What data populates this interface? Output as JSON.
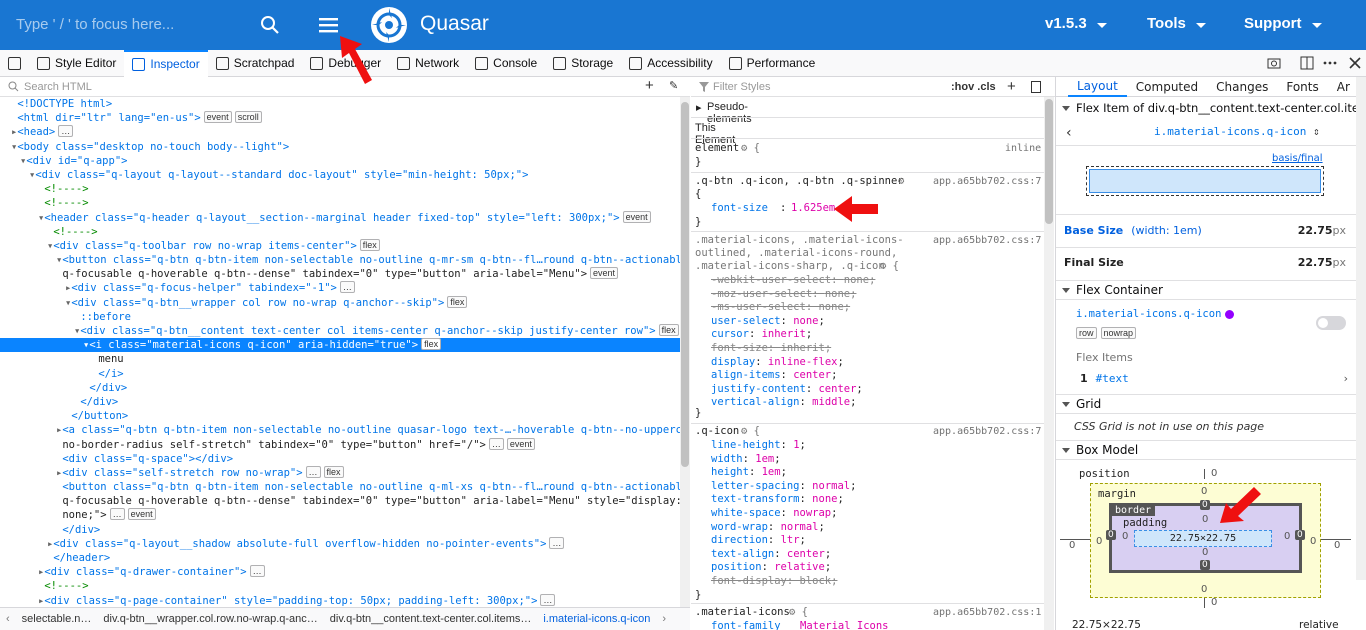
{
  "header": {
    "search_placeholder": "Type ' / ' to focus here...",
    "brand": "Quasar",
    "version": "v1.5.3",
    "tools": "Tools",
    "support": "Support",
    "brand_color": "#1976d2"
  },
  "devtools": {
    "tabs": [
      "Style Editor",
      "Inspector",
      "Scratchpad",
      "Debugger",
      "Network",
      "Console",
      "Storage",
      "Accessibility",
      "Performance"
    ],
    "selected_tab": "Inspector",
    "search_html_placeholder": "Search HTML",
    "tree": [
      "<!DOCTYPE html>",
      "<html dir=\"ltr\" lang=\"en-us\">",
      "<head>",
      "<body class=\"desktop no-touch body--light\">",
      "<div id=\"q-app\">",
      "<div class=\"q-layout q-layout--standard doc-layout\" style=\"min-height: 50px;\">",
      "<!---->",
      "<!---->",
      "<header class=\"q-header q-layout__section--marginal header fixed-top\" style=\"left: 300px;\">",
      "<!---->",
      "<div class=\"q-toolbar row no-wrap items-center\">",
      "<button class=\"q-btn q-btn-item non-selectable no-outline q-mr-sm q-btn--fl…round q-btn--actionable",
      "q-focusable q-hoverable q-btn--dense\" tabindex=\"0\" type=\"button\" aria-label=\"Menu\">",
      "<div class=\"q-focus-helper\" tabindex=\"-1\">",
      "<div class=\"q-btn__wrapper col row no-wrap q-anchor--skip\">",
      "::before",
      "<div class=\"q-btn__content text-center col items-center q-anchor--skip justify-center row\">",
      "<i class=\"material-icons q-icon\" aria-hidden=\"true\">",
      "menu",
      "</i>",
      "</div>",
      "</div>",
      "</button>",
      "<a class=\"q-btn q-btn-item non-selectable no-outline quasar-logo text-…-hoverable q-btn--no-uppercase",
      "no-border-radius self-stretch\" tabindex=\"0\" type=\"button\" href=\"/\">",
      "<div class=\"q-space\"></div>",
      "<div class=\"self-stretch row no-wrap\">",
      "<button class=\"q-btn q-btn-item non-selectable no-outline q-ml-xs q-btn--fl…round q-btn--actionable",
      "q-focusable q-hoverable q-btn--dense\" tabindex=\"0\" type=\"button\" aria-label=\"Menu\" style=\"display:",
      "none;\">",
      "</div>",
      "<div class=\"q-layout__shadow absolute-full overflow-hidden no-pointer-events\">",
      "</header>",
      "<div class=\"q-drawer-container\">",
      "<!---->",
      "<div class=\"q-page-container\" style=\"padding-top: 50px; padding-left: 300px;\">"
    ],
    "badges": {
      "event": "event",
      "scroll": "scroll",
      "flex": "flex"
    },
    "breadcrumbs": [
      "selectable.n…",
      "div.q-btn__wrapper.col.row.no-wrap.q-anc…",
      "div.q-btn__content.text-center.col.items…",
      "i.material-icons.q-icon"
    ]
  },
  "rules": {
    "filter_placeholder": "Filter Styles",
    "hov_cls": ":hov .cls",
    "pseudo": "Pseudo-elements",
    "this_element": "This Element",
    "element_rule": "element",
    "inline": "inline",
    "r1_selector": ".q-btn .q-icon, .q-btn .q-spinner",
    "r1_source": "app.a65bb702.css:7",
    "r1_prop": "font-size",
    "r1_val": "1.625em",
    "r2_selector_a": ".material-icons, .material-icons-",
    "r2_selector_b": "outlined, .material-icons-round,",
    "r2_selector_c": ".material-icons-sharp, .q-icon",
    "r2_source": "app.a65bb702.css:7",
    "r2_props": [
      [
        "-webkit-user-select",
        "none",
        true
      ],
      [
        "-moz-user-select",
        "none",
        true
      ],
      [
        "-ms-user-select",
        "none",
        true
      ],
      [
        "user-select",
        "none",
        false
      ],
      [
        "cursor",
        "inherit",
        false
      ],
      [
        "font-size",
        "inherit",
        true
      ],
      [
        "display",
        "inline-flex",
        false
      ],
      [
        "align-items",
        "center",
        false
      ],
      [
        "justify-content",
        "center",
        false
      ],
      [
        "vertical-align",
        "middle",
        false
      ]
    ],
    "r3_selector": ".q-icon",
    "r3_source": "app.a65bb702.css:7",
    "r3_props": [
      [
        "line-height",
        "1",
        false
      ],
      [
        "width",
        "1em",
        false
      ],
      [
        "height",
        "1em",
        false
      ],
      [
        "letter-spacing",
        "normal",
        false
      ],
      [
        "text-transform",
        "none",
        false
      ],
      [
        "white-space",
        "nowrap",
        false
      ],
      [
        "word-wrap",
        "normal",
        false
      ],
      [
        "direction",
        "ltr",
        false
      ],
      [
        "text-align",
        "center",
        false
      ],
      [
        "position",
        "relative",
        false
      ],
      [
        "font-display",
        "block",
        true
      ]
    ],
    "r4_selector": ".material-icons",
    "r4_source": "app.a65bb702.css:1",
    "r4_prop": "font-family",
    "r4_val": "Material Icons"
  },
  "layout": {
    "tabs": [
      "Layout",
      "Computed",
      "Changes",
      "Fonts",
      "Ar"
    ],
    "flex_item_title": "Flex Item of div.q-btn__content.text-center.col.ite…",
    "item_selector": "i.material-icons.q-icon",
    "basis_label": "basis/final",
    "base_size_label": "Base Size",
    "base_size_note": "(width: 1em)",
    "base_size_value": "22.75",
    "final_size_label": "Final Size",
    "final_size_value": "22.75",
    "px": "px",
    "flex_container": "Flex Container",
    "container_selector": "i.material-icons.q-icon",
    "row": "row",
    "nowrap": "nowrap",
    "flex_items": "Flex Items",
    "flex_item_index": "1",
    "flex_item_text": "#text",
    "grid": "Grid",
    "grid_note": "CSS Grid is not in use on this page",
    "box_model": "Box Model",
    "bm_position": "position",
    "bm_margin": "margin",
    "bm_border": "border",
    "bm_padding": "padding",
    "bm_content": "22.75×22.75",
    "bm_zero": "0",
    "dims": "22.75×22.75",
    "pos_value": "relative"
  }
}
